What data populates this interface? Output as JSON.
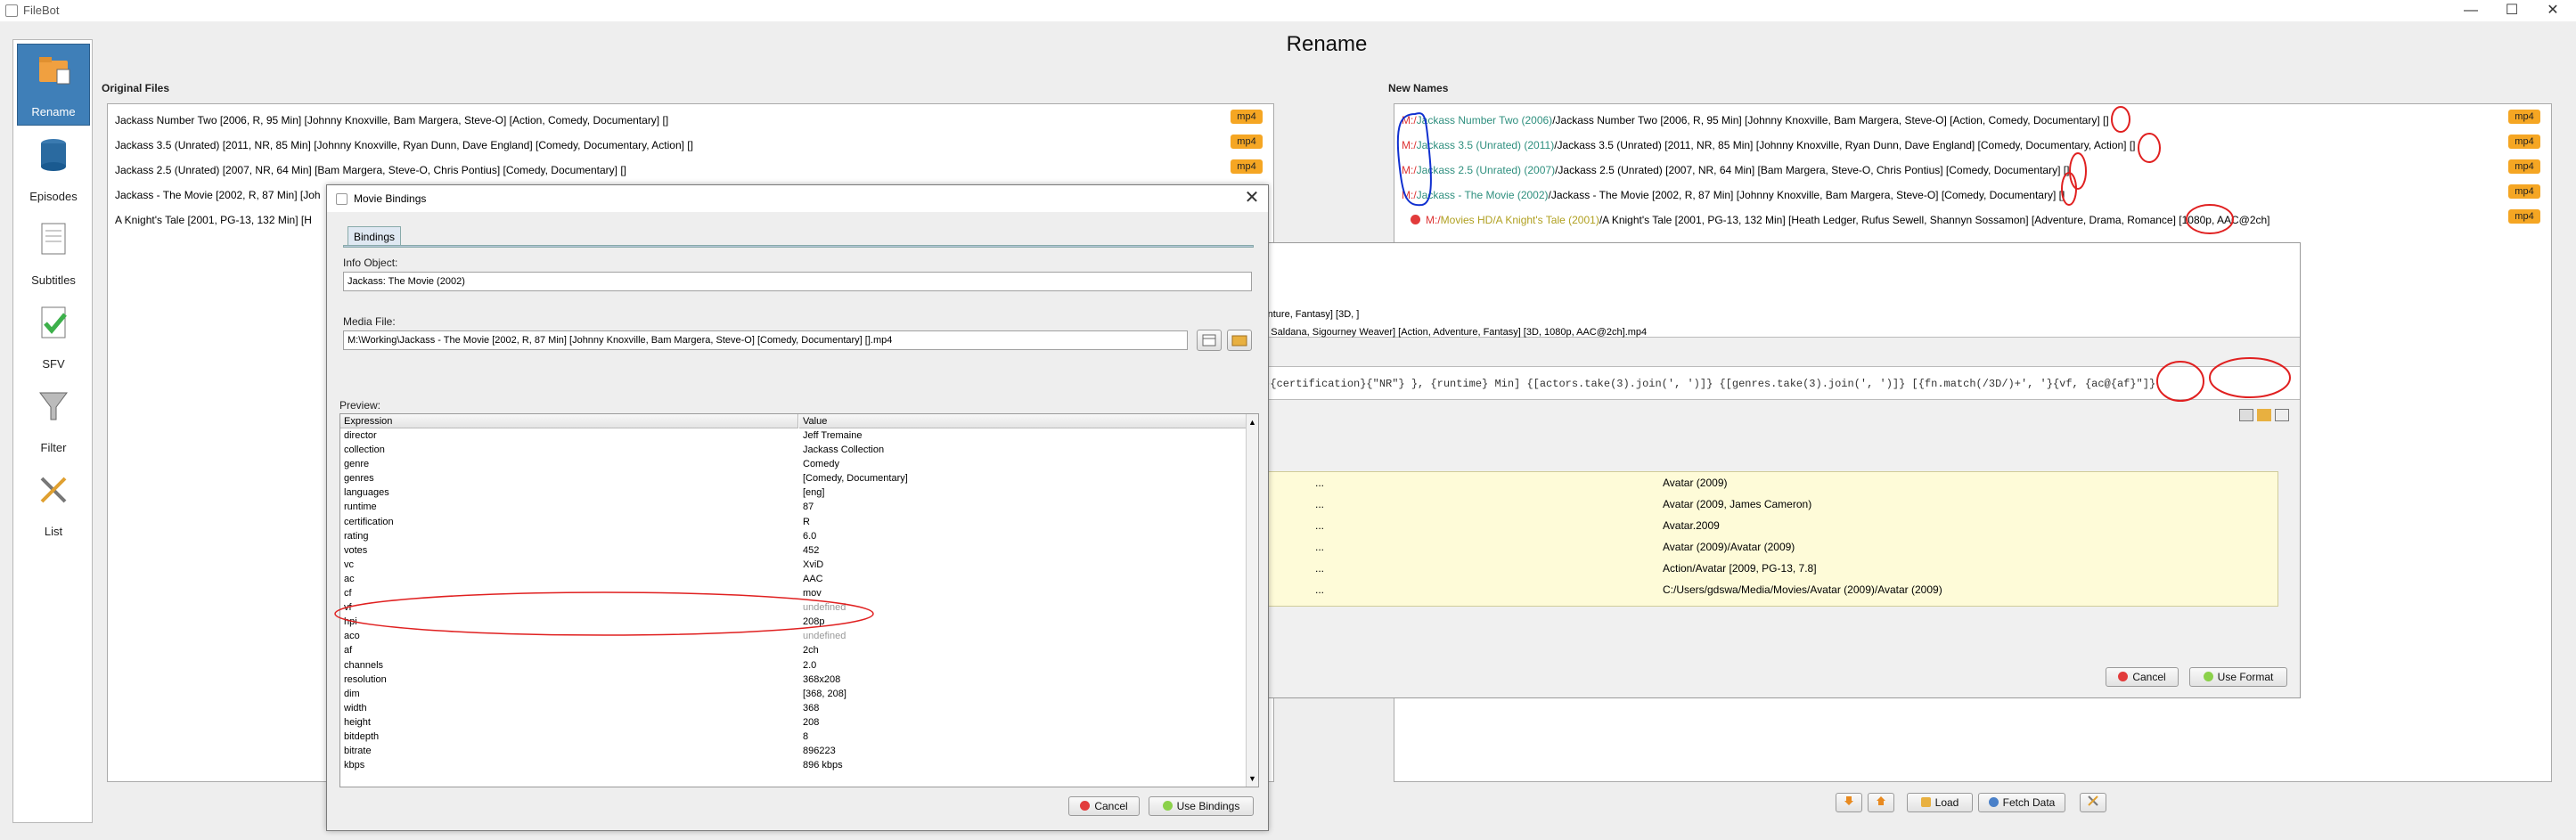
{
  "window": {
    "title": "FileBot",
    "controls": [
      "—",
      "☐",
      "✕"
    ]
  },
  "sidebar": {
    "items": [
      {
        "label": "Rename",
        "icon": "rename-icon",
        "active": true
      },
      {
        "label": "Episodes",
        "icon": "episodes-icon",
        "active": false
      },
      {
        "label": "Subtitles",
        "icon": "subtitles-icon",
        "active": false
      },
      {
        "label": "SFV",
        "icon": "sfv-icon",
        "active": false
      },
      {
        "label": "Filter",
        "icon": "filter-icon",
        "active": false
      },
      {
        "label": "List",
        "icon": "list-icon",
        "active": false
      }
    ]
  },
  "page": {
    "title": "Rename"
  },
  "original": {
    "label": "Original Files",
    "files": [
      {
        "name": "Jackass Number Two [2006, R, 95 Min] [Johnny Knoxville, Bam Margera, Steve-O] [Action, Comedy, Documentary] []",
        "ext": "mp4"
      },
      {
        "name": "Jackass 3.5 (Unrated) [2011, NR, 85 Min] [Johnny Knoxville, Ryan Dunn, Dave England] [Comedy, Documentary, Action] []",
        "ext": "mp4"
      },
      {
        "name": "Jackass 2.5 (Unrated) [2007, NR, 64 Min] [Bam Margera, Steve-O, Chris Pontius] [Comedy, Documentary] []",
        "ext": "mp4"
      },
      {
        "name": "Jackass - The Movie [2002, R, 87 Min] [Joh",
        "ext": "mp4"
      },
      {
        "name": "A Knight's Tale [2001, PG-13, 132 Min] [H",
        "ext": ""
      }
    ]
  },
  "newnames": {
    "label": "New Names",
    "files": [
      {
        "prefix": "M:/",
        "folder": "Jackass Number Two (2006)",
        "rest": "/Jackass Number Two [2006, R, 95 Min] [Johnny Knoxville, Bam Margera, Steve-O] [Action, Comedy, Documentary] []",
        "ext": "mp4"
      },
      {
        "prefix": "M:/",
        "folder": "Jackass 3.5 (Unrated) (2011)",
        "rest": "/Jackass 3.5 (Unrated) [2011, NR, 85 Min] [Johnny Knoxville, Ryan Dunn, Dave England] [Comedy, Documentary, Action] []",
        "ext": "mp4"
      },
      {
        "prefix": "M:/",
        "folder": "Jackass 2.5 (Unrated) (2007)",
        "rest": "/Jackass 2.5 (Unrated) [2007, NR, 64 Min] [Bam Margera, Steve-O, Chris Pontius] [Comedy, Documentary] []",
        "ext": "mp4"
      },
      {
        "prefix": "M:/",
        "folder": "Jackass - The Movie (2002)",
        "rest": "/Jackass - The Movie [2002, R, 87 Min] [Johnny Knoxville, Bam Margera, Steve-O] [Comedy, Documentary] []",
        "ext": "mp4"
      },
      {
        "prefix": "M:/",
        "folder": "Movies HD/A Knight's Tale (2001)",
        "rest": "/A Knight's Tale [2001, PG-13, 132 Min] [Heath Ledger, Rufus Sewell, Shannyn Sossamon] [Adventure, Drama, Romance] [1080p, AAC@2ch]",
        "ext": "mp4"
      }
    ]
  },
  "bottom_buttons": {
    "down": "",
    "up": "",
    "load": "Load",
    "fetch": "Fetch Data",
    "settings": ""
  },
  "format_dialog": {
    "line1": "venture, Fantasy] [3D, ]",
    "line2": "oe Saldana, Sigourney Weaver] [Action, Adventure, Fantasy] [3D, 1080p, AAC@2ch].mp4",
    "expression": "n}{certification}{\"NR\"} }, {runtime} Min] {[actors.take(3).join(', ')]} {[genres.take(3).join(', ')]} [{fn.match(/3D/)+', '}{vf, {ac@{af}\"]}",
    "table": [
      {
        "dots": "...",
        "value": "Avatar (2009)"
      },
      {
        "dots": "...",
        "value": "Avatar (2009, James Cameron)"
      },
      {
        "dots": "...",
        "value": "Avatar.2009"
      },
      {
        "dots": "...",
        "value": "Avatar (2009)/Avatar (2009)"
      },
      {
        "dots": "...",
        "value": "Action/Avatar [2009, PG-13, 7.8]"
      },
      {
        "dots": "...",
        "value": "C:/Users/gdswa/Media/Movies/Avatar (2009)/Avatar (2009)"
      }
    ],
    "cancel": "Cancel",
    "use": "Use Format"
  },
  "bindings_dialog": {
    "title": "Movie Bindings",
    "tab": "Bindings",
    "info_label": "Info Object:",
    "info_value": "Jackass: The Movie (2002)",
    "media_label": "Media File:",
    "media_value": "M:\\Working\\Jackass - The Movie [2002, R, 87 Min] [Johnny Knoxville, Bam Margera, Steve-O] [Comedy, Documentary] [].mp4",
    "preview_label": "Preview:",
    "col_expression": "Expression",
    "col_value": "Value",
    "rows": [
      [
        "director",
        "Jeff Tremaine",
        false
      ],
      [
        "collection",
        "Jackass Collection",
        false
      ],
      [
        "genre",
        "Comedy",
        false
      ],
      [
        "genres",
        "[Comedy, Documentary]",
        false
      ],
      [
        "languages",
        "[eng]",
        false
      ],
      [
        "runtime",
        "87",
        false
      ],
      [
        "certification",
        "R",
        false
      ],
      [
        "rating",
        "6.0",
        false
      ],
      [
        "votes",
        "452",
        false
      ],
      [
        "vc",
        "XviD",
        false
      ],
      [
        "ac",
        "AAC",
        false
      ],
      [
        "cf",
        "mov",
        false
      ],
      [
        "vf",
        "undefined",
        true
      ],
      [
        "hpi",
        "208p",
        false
      ],
      [
        "aco",
        "undefined",
        true
      ],
      [
        "af",
        "2ch",
        false
      ],
      [
        "channels",
        "2.0",
        false
      ],
      [
        "resolution",
        "368x208",
        false
      ],
      [
        "dim",
        "[368, 208]",
        false
      ],
      [
        "width",
        "368",
        false
      ],
      [
        "height",
        "208",
        false
      ],
      [
        "bitdepth",
        "8",
        false
      ],
      [
        "bitrate",
        "896223",
        false
      ],
      [
        "kbps",
        "896 kbps",
        false
      ]
    ],
    "cancel": "Cancel",
    "use": "Use Bindings"
  },
  "colors": {
    "accent": "#3f7fb8",
    "badge": "#f5a623",
    "annotation_red": "#e02020",
    "annotation_blue": "#1030d0"
  }
}
